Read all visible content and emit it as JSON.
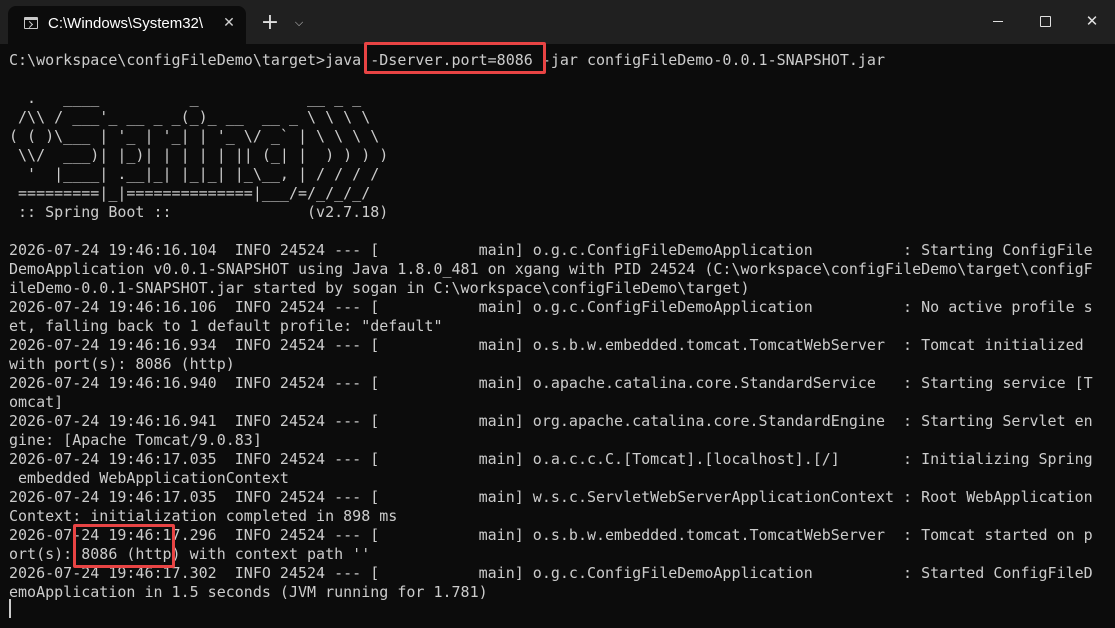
{
  "window": {
    "tab_title": "C:\\Windows\\System32\\",
    "tab_close": "✕",
    "new_tab": "+",
    "dropdown": "⌵",
    "close_glyph": "✕"
  },
  "terminal": {
    "lines": [
      "C:\\workspace\\configFileDemo\\target>java -Dserver.port=8086 -jar configFileDemo-0.0.1-SNAPSHOT.jar",
      "",
      "  .   ____          _            __ _ _",
      " /\\\\ / ___'_ __ _ _(_)_ __  __ _ \\ \\ \\ \\",
      "( ( )\\___ | '_ | '_| | '_ \\/ _` | \\ \\ \\ \\",
      " \\\\/  ___)| |_)| | | | | || (_| |  ) ) ) )",
      "  '  |____| .__|_| |_|_| |_\\__, | / / / /",
      " =========|_|==============|___/=/_/_/_/",
      " :: Spring Boot ::               (v2.7.18)",
      "",
      "2026-07-24 19:46:16.104  INFO 24524 --- [           main] o.g.c.ConfigFileDemoApplication          : Starting ConfigFile",
      "DemoApplication v0.0.1-SNAPSHOT using Java 1.8.0_481 on xgang with PID 24524 (C:\\workspace\\configFileDemo\\target\\configF",
      "ileDemo-0.0.1-SNAPSHOT.jar started by sogan in C:\\workspace\\configFileDemo\\target)",
      "2026-07-24 19:46:16.106  INFO 24524 --- [           main] o.g.c.ConfigFileDemoApplication          : No active profile s",
      "et, falling back to 1 default profile: \"default\"",
      "2026-07-24 19:46:16.934  INFO 24524 --- [           main] o.s.b.w.embedded.tomcat.TomcatWebServer  : Tomcat initialized",
      "with port(s): 8086 (http)",
      "2026-07-24 19:46:16.940  INFO 24524 --- [           main] o.apache.catalina.core.StandardService   : Starting service [T",
      "omcat]",
      "2026-07-24 19:46:16.941  INFO 24524 --- [           main] org.apache.catalina.core.StandardEngine  : Starting Servlet en",
      "gine: [Apache Tomcat/9.0.83]",
      "2026-07-24 19:46:17.035  INFO 24524 --- [           main] o.a.c.c.C.[Tomcat].[localhost].[/]       : Initializing Spring",
      " embedded WebApplicationContext",
      "2026-07-24 19:46:17.035  INFO 24524 --- [           main] w.s.c.ServletWebServerApplicationContext : Root WebApplication",
      "Context: initialization completed in 898 ms",
      "2026-07-24 19:46:17.296  INFO 24524 --- [           main] o.s.b.w.embedded.tomcat.TomcatWebServer  : Tomcat started on p",
      "ort(s): 8086 (http) with context path ''",
      "2026-07-24 19:46:17.302  INFO 24524 --- [           main] o.g.c.ConfigFileDemoApplication          : Started ConfigFileD",
      "emoApplication in 1.5 seconds (JVM running for 1.781)"
    ]
  },
  "colors": {
    "background": "#0c0c0c",
    "titlebar": "#202020",
    "text": "#cccccc",
    "highlight": "#e84444"
  }
}
